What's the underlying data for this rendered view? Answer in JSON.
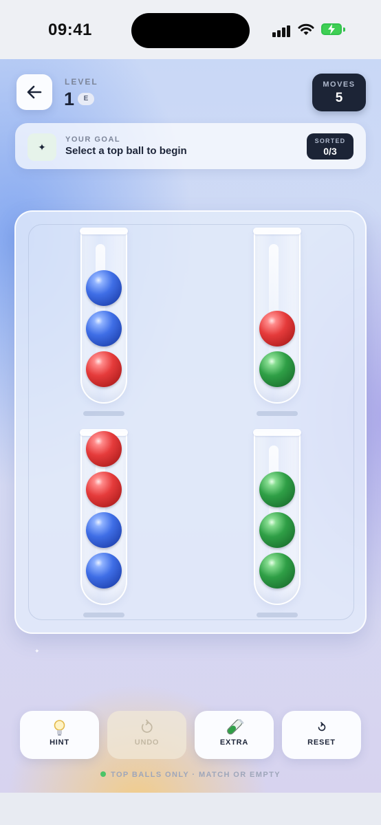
{
  "status_bar": {
    "time": "09:41",
    "icons": [
      "cellular-signal-icon",
      "wifi-icon",
      "battery-charging-icon"
    ],
    "battery_color": "#3fcf54"
  },
  "header": {
    "level_label": "LEVEL",
    "level_value": "1",
    "difficulty_badge": "E",
    "moves_label": "MOVES",
    "moves_value": "5"
  },
  "goal": {
    "label": "YOUR GOAL",
    "text": "Select a top ball to begin",
    "icon": "sparkle-icon",
    "sorted_label": "SORTED",
    "sorted_value": "0/3"
  },
  "board": {
    "colors": {
      "blue": "#3f6ee6",
      "red": "#e53b3b",
      "green": "#2f9f46"
    },
    "tubes": [
      {
        "id": "tube-1",
        "balls_top_to_bottom": [
          "blue",
          "blue",
          "red"
        ]
      },
      {
        "id": "tube-2",
        "balls_top_to_bottom": [
          "red",
          "green"
        ]
      },
      {
        "id": "tube-3",
        "balls_top_to_bottom": [
          "red",
          "red",
          "blue",
          "blue"
        ]
      },
      {
        "id": "tube-4",
        "balls_top_to_bottom": [
          "green",
          "green",
          "green"
        ]
      }
    ]
  },
  "actions": [
    {
      "id": "hint",
      "label": "HINT",
      "icon": "lightbulb-icon",
      "enabled": true
    },
    {
      "id": "undo",
      "label": "UNDO",
      "icon": "undo-icon",
      "enabled": false
    },
    {
      "id": "extra",
      "label": "EXTRA",
      "icon": "test-tube-icon",
      "enabled": true
    },
    {
      "id": "reset",
      "label": "RESET",
      "icon": "reset-icon",
      "enabled": true
    }
  ],
  "footer_hint": "TOP BALLS ONLY · MATCH OR EMPTY"
}
